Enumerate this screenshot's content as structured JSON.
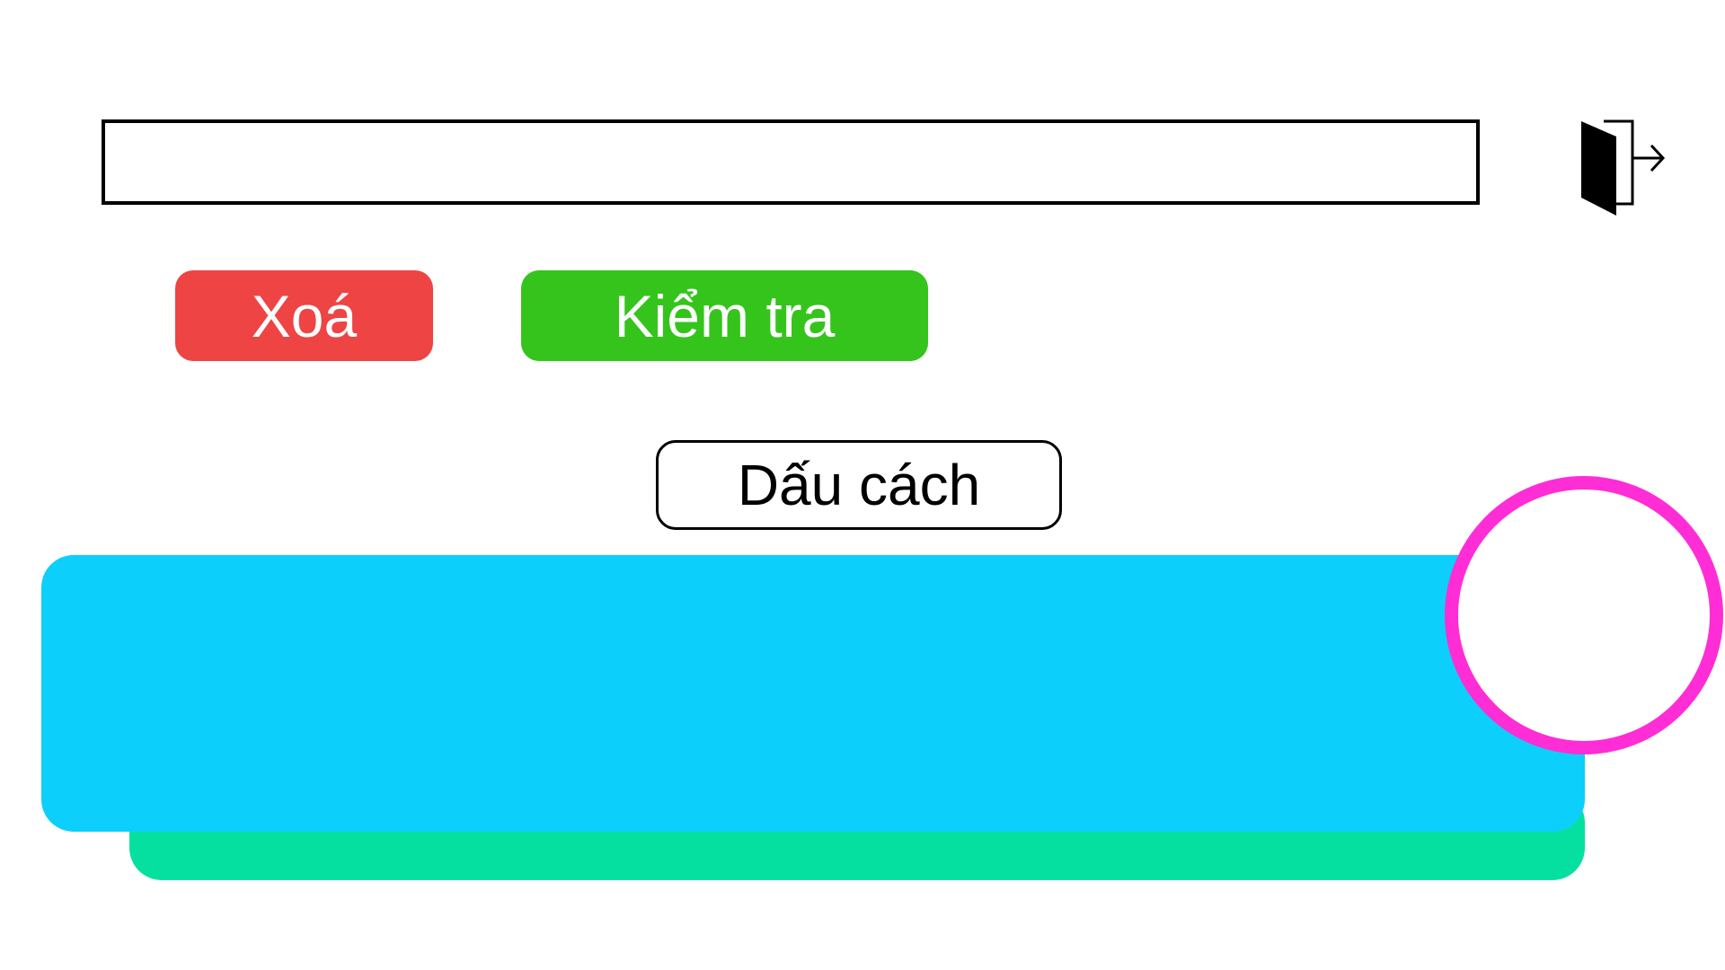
{
  "answer_input": {
    "value": "",
    "placeholder": ""
  },
  "toolbar": {
    "exit_icon": "exit-door-icon",
    "delete_label": "Xoá",
    "check_label": "Kiểm tra"
  },
  "keyboard": {
    "space_label": "Dấu cách"
  },
  "colors": {
    "delete_button": "#EE4444",
    "check_button": "#35C41C",
    "keyboard_panel": "#0DCFFC",
    "keyboard_shadow": "#05E0A1",
    "record_ring": "#FF2DD6"
  }
}
